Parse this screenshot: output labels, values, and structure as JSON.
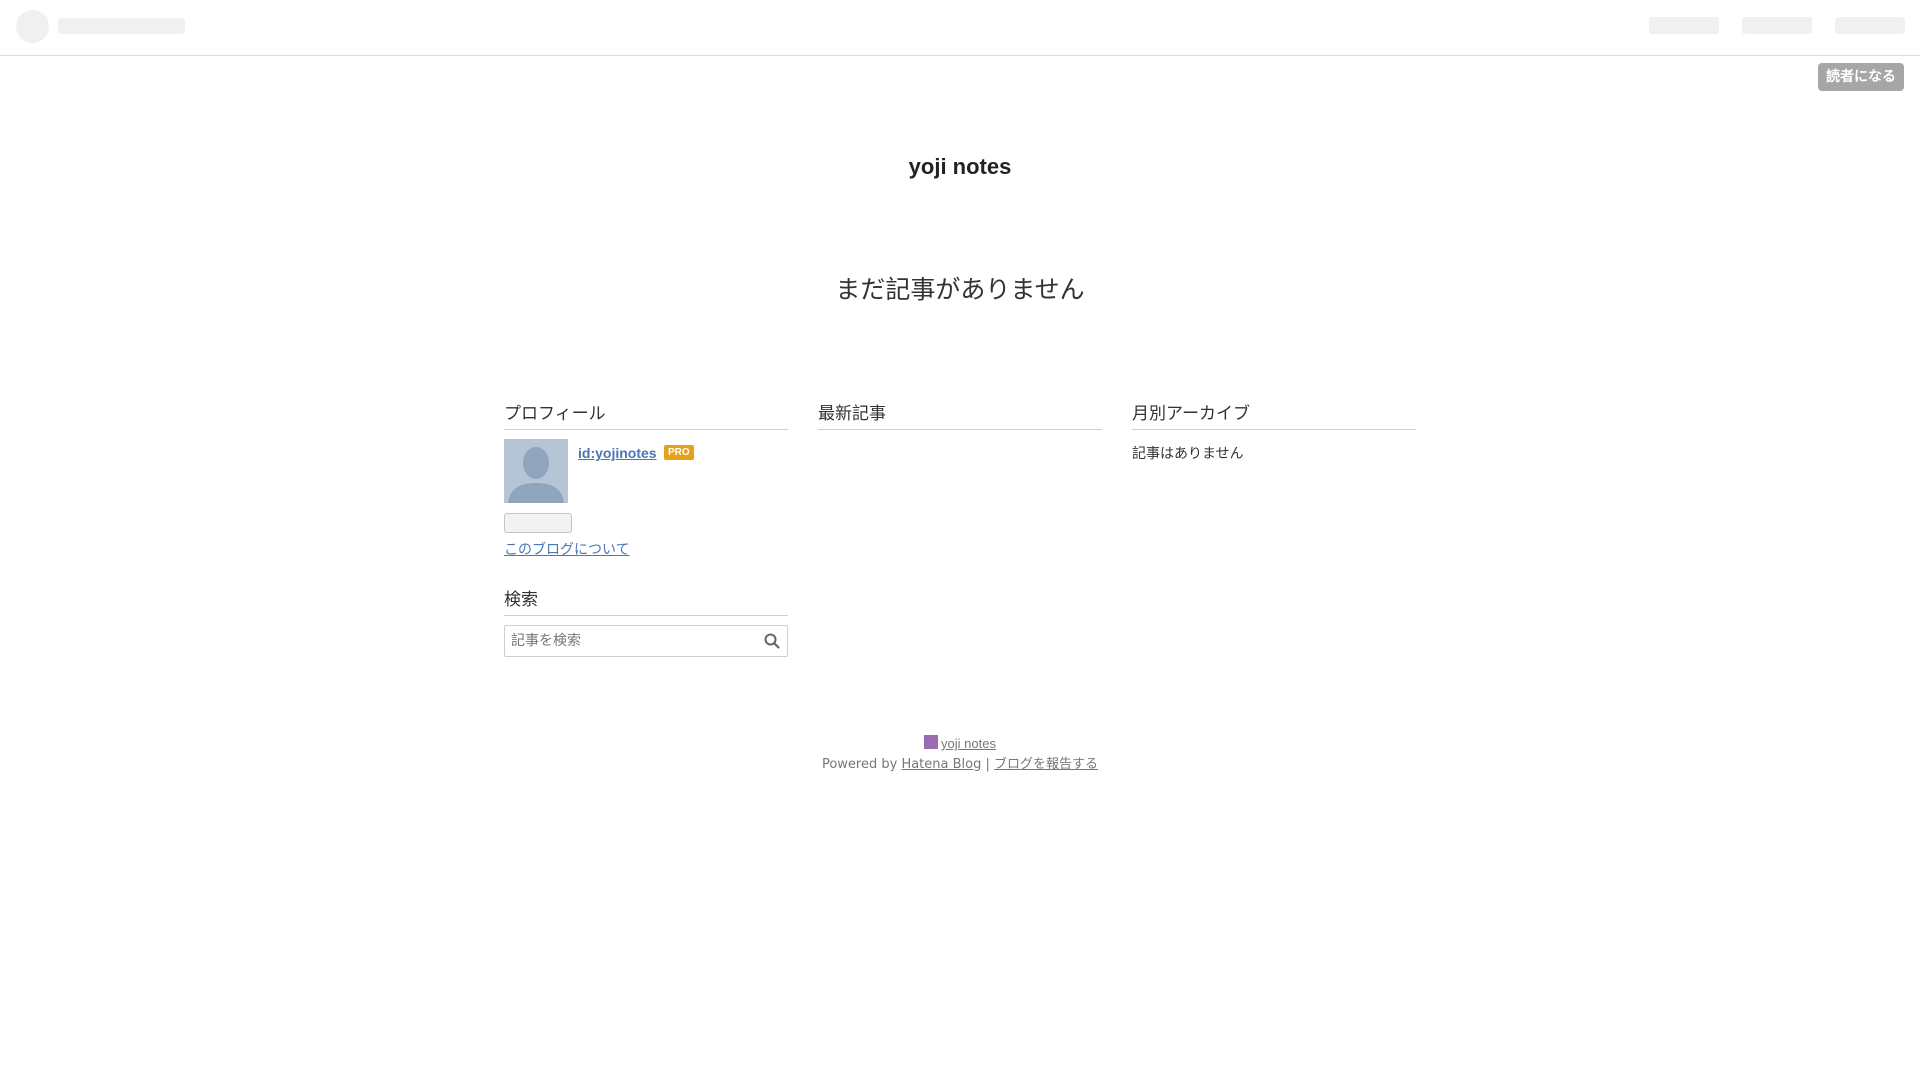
{
  "header": {
    "subscribe_label": "読者になる"
  },
  "blog": {
    "title": "yoji notes",
    "no_entries": "まだ記事がありません"
  },
  "sidebar": {
    "profile": {
      "title": "プロフィール",
      "user_id": "id:yojinotes",
      "badge": "PRO",
      "about_link": "このブログについて"
    },
    "search": {
      "title": "検索",
      "placeholder": "記事を検索",
      "icon": "search-icon"
    },
    "recent": {
      "title": "最新記事"
    },
    "archive": {
      "title": "月別アーカイブ",
      "empty_text": "記事はありません"
    }
  },
  "footer": {
    "blog_name": "yoji notes",
    "powered_prefix": "Powered by",
    "hatena_link": "Hatena Blog",
    "separator": "|",
    "report_link": "ブログを報告する"
  },
  "colors": {
    "link": "#4a76b5",
    "pro_badge": "#e6a11a",
    "subscribe_button": "#a6a6a6",
    "footer_icon": "#9b6bb1"
  }
}
